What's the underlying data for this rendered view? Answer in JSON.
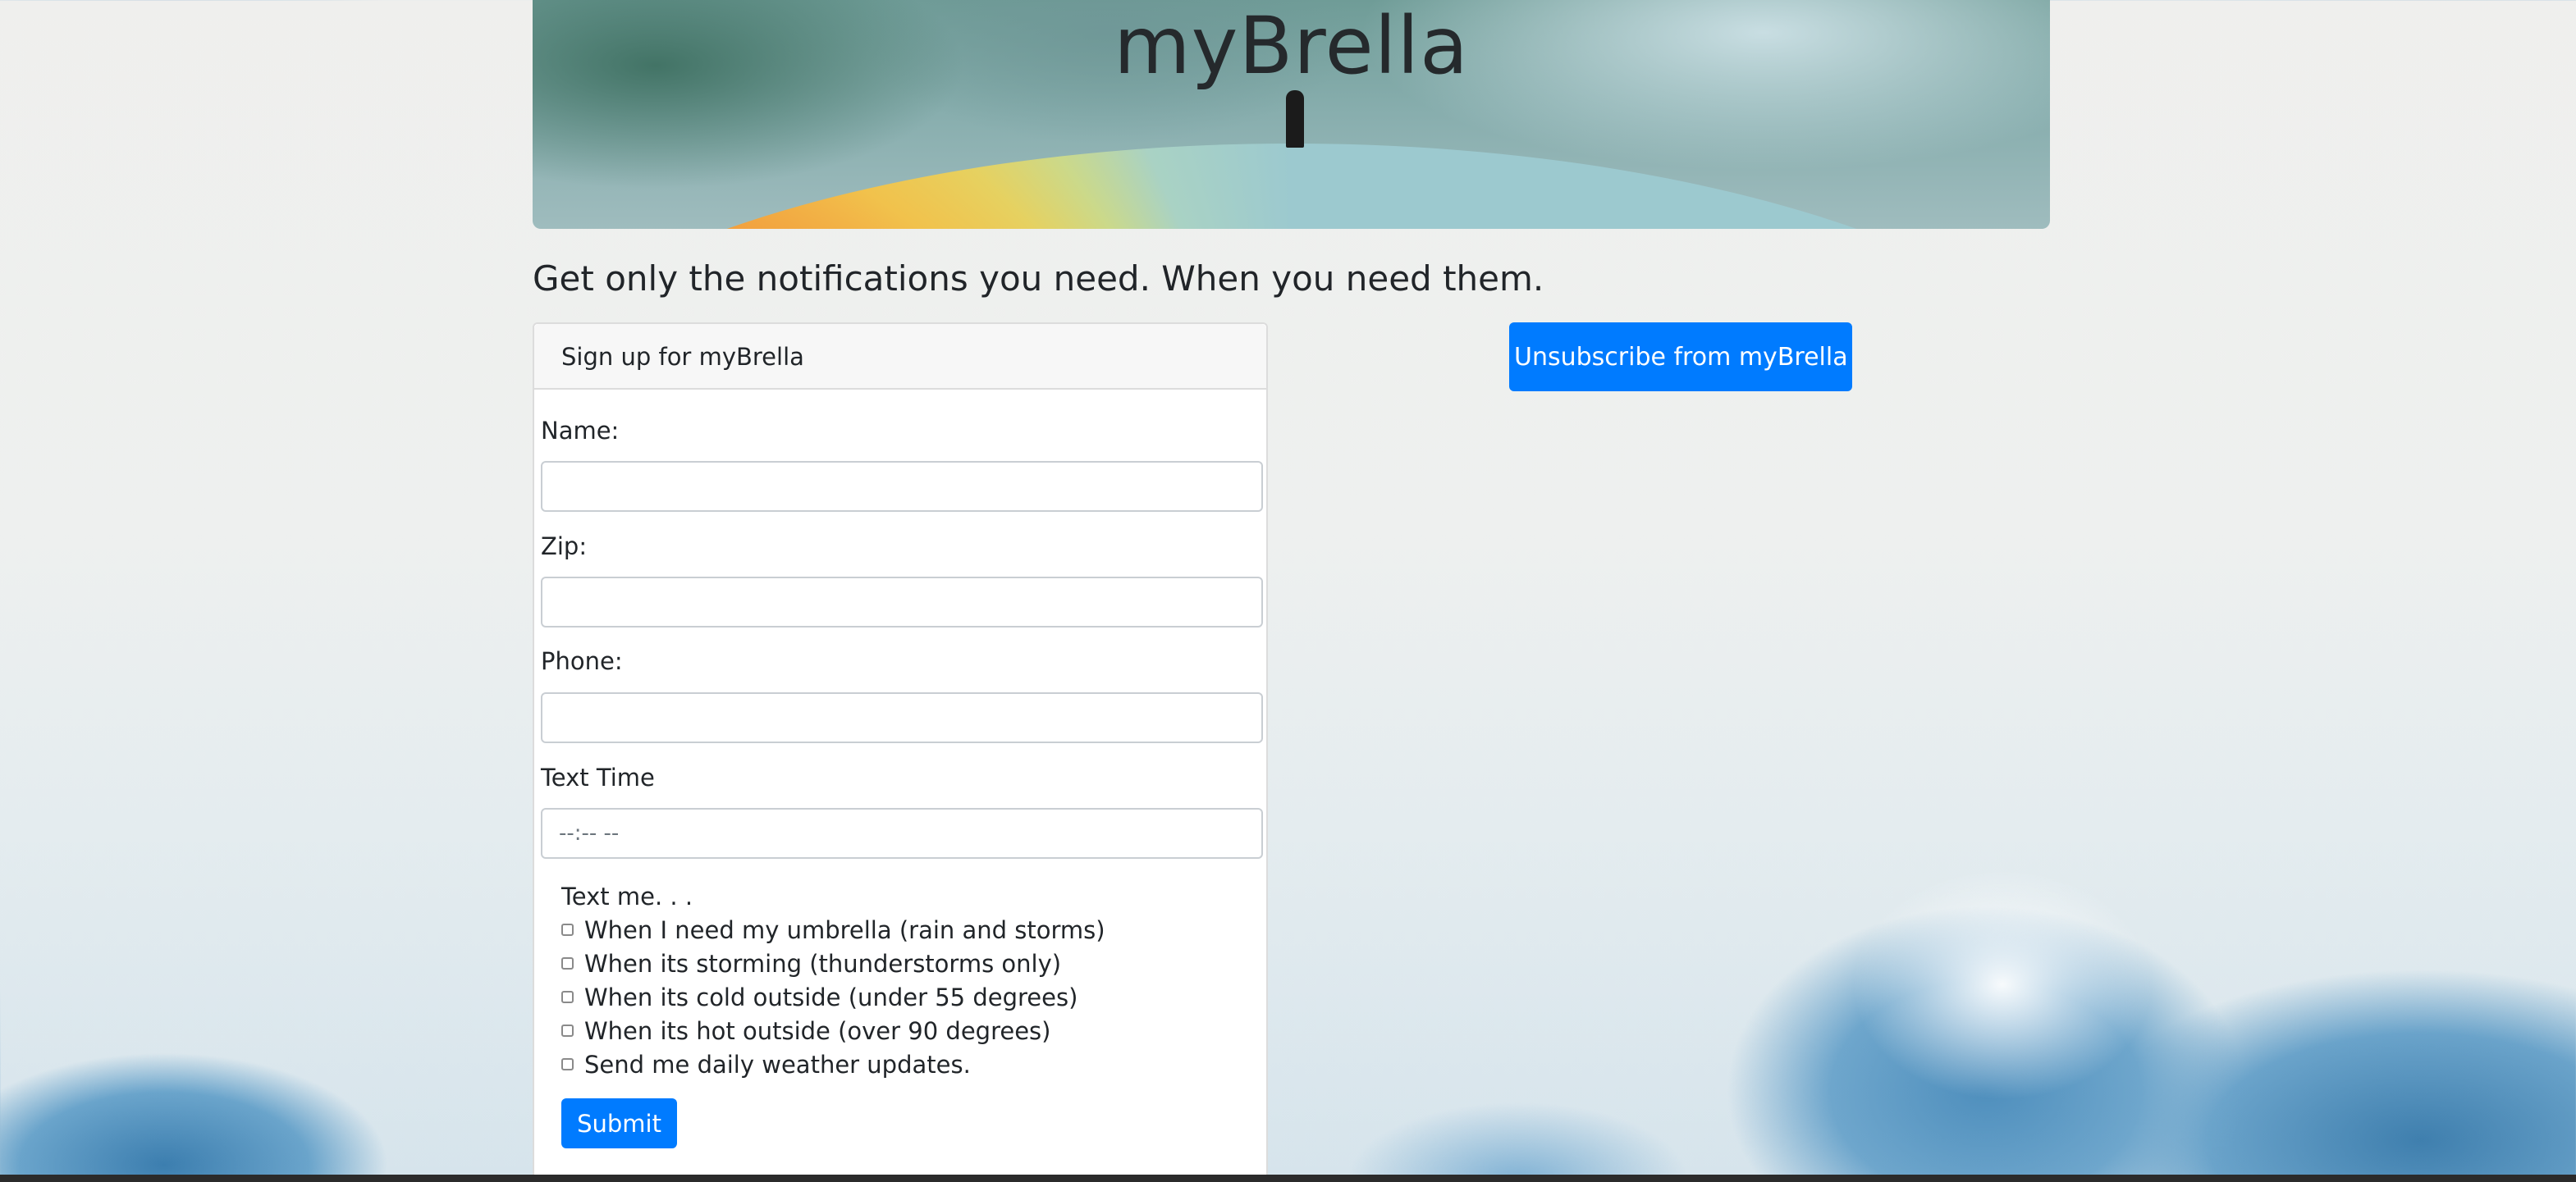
{
  "header": {
    "title": "myBrella",
    "tagline": "Get only the notifications you need. When you need them."
  },
  "signup": {
    "card_title": "Sign up for myBrella",
    "fields": {
      "name_label": "Name:",
      "zip_label": "Zip:",
      "phone_label": "Phone:",
      "time_label": "Text Time",
      "time_placeholder": "--:-- --"
    },
    "options_title": "Text me. . .",
    "options": [
      {
        "label": "When I need my umbrella (rain and storms)",
        "checked": false
      },
      {
        "label": "When its storming (thunderstorms only)",
        "checked": false
      },
      {
        "label": "When its cold outside (under 55 degrees)",
        "checked": false
      },
      {
        "label": "When its hot outside (over 90 degrees)",
        "checked": false
      },
      {
        "label": "Send me daily weather updates.",
        "checked": false
      }
    ],
    "submit_label": "Submit"
  },
  "unsubscribe": {
    "label": "Unsubscribe from myBrella"
  },
  "colors": {
    "primary": "#007bff",
    "text": "#212529",
    "card_header_bg": "#f7f7f7"
  }
}
